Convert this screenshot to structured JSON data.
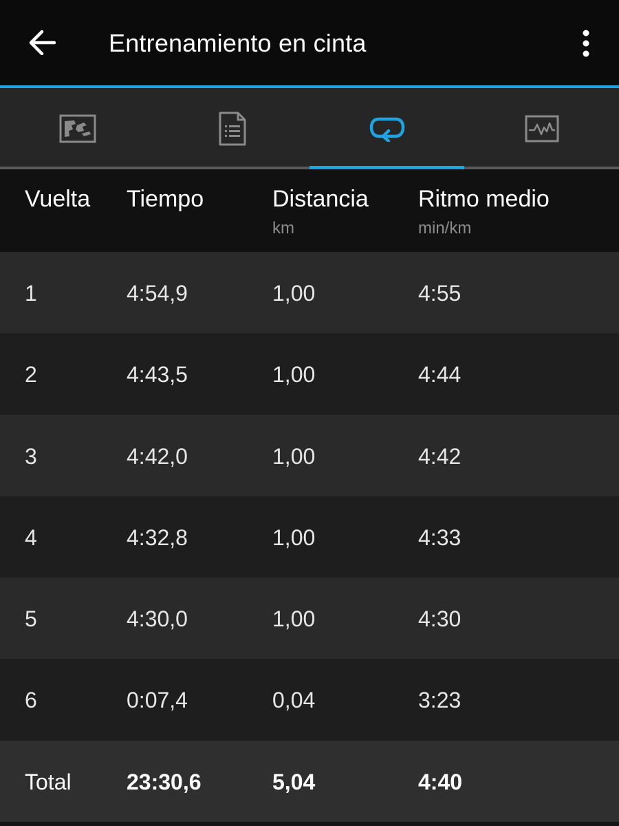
{
  "appbar": {
    "title": "Entrenamiento en cinta",
    "back_icon": "arrow-left-icon",
    "menu_icon": "more-vertical-icon"
  },
  "tabs": [
    {
      "name": "map-tab",
      "icon": "map-icon",
      "selected": false
    },
    {
      "name": "details-tab",
      "icon": "document-list-icon",
      "selected": false
    },
    {
      "name": "laps-tab",
      "icon": "loop-icon",
      "selected": true
    },
    {
      "name": "charts-tab",
      "icon": "activity-chart-icon",
      "selected": false
    }
  ],
  "colors": {
    "accent": "#1ea4e0",
    "icon_inactive": "#8a8a8a",
    "background": "#232323"
  },
  "table": {
    "headers": [
      {
        "label": "Vuelta",
        "unit": ""
      },
      {
        "label": "Tiempo",
        "unit": ""
      },
      {
        "label": "Distancia",
        "unit": "km"
      },
      {
        "label": "Ritmo medio",
        "unit": "min/km"
      }
    ],
    "rows": [
      [
        "1",
        "4:54,9",
        "1,00",
        "4:55"
      ],
      [
        "2",
        "4:43,5",
        "1,00",
        "4:44"
      ],
      [
        "3",
        "4:42,0",
        "1,00",
        "4:42"
      ],
      [
        "4",
        "4:32,8",
        "1,00",
        "4:33"
      ],
      [
        "5",
        "4:30,0",
        "1,00",
        "4:30"
      ],
      [
        "6",
        "0:07,4",
        "0,04",
        "3:23"
      ]
    ],
    "total": [
      "Total",
      "23:30,6",
      "5,04",
      "4:40"
    ]
  }
}
